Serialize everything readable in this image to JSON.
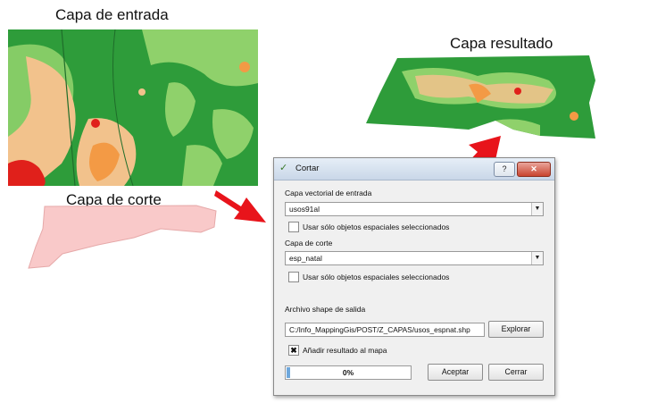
{
  "captions": {
    "input_layer": "Capa de entrada",
    "clip_layer": "Capa de corte",
    "result_layer": "Capa resultado"
  },
  "map_colors": {
    "dark_green": "#2e9c3a",
    "light_green": "#8fd16b",
    "mid_green": "#5cb85c",
    "tan": "#f2c28c",
    "orange": "#f39a45",
    "red": "#e0201b",
    "clip_fill": "#f9c9c9",
    "arrow": "#e8141b"
  },
  "dialog": {
    "title": "Cortar",
    "help_label": "?",
    "close_label": "✕",
    "input_vector_label": "Capa vectorial de entrada",
    "input_vector_value": "usos91al",
    "input_selected_only": "Usar sólo objetos espaciales seleccionados",
    "clip_layer_label": "Capa de corte",
    "clip_layer_value": "esp_natal",
    "clip_selected_only": "Usar sólo objetos espaciales seleccionados",
    "output_shape_label": "Archivo shape de salida",
    "output_path": "C:/Info_MappingGis/POST/Z_CAPAS/usos_espnat.shp",
    "browse_button": "Explorar",
    "add_result_label": "Añadir resultado al mapa",
    "add_result_checked": "✖",
    "progress_text": "0%",
    "progress_value": 0.03,
    "accept_button": "Aceptar",
    "close_button": "Cerrar"
  }
}
